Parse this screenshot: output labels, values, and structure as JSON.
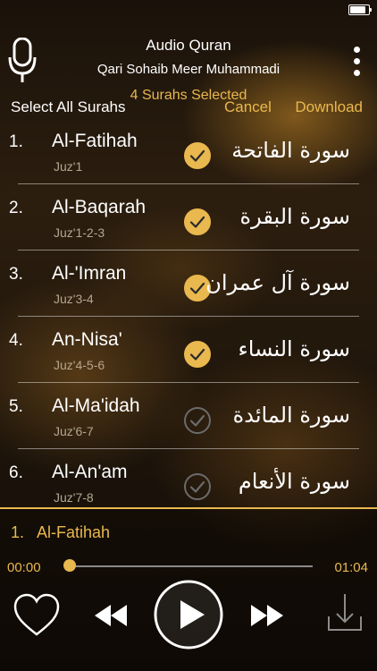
{
  "header": {
    "title": "Audio Quran",
    "reciter": "Qari Sohaib Meer Muhammadi",
    "selected_count": "4 Surahs Selected"
  },
  "actions": {
    "select_all": "Select All Surahs",
    "cancel": "Cancel",
    "download": "Download"
  },
  "surahs": [
    {
      "num": "1.",
      "name": "Al-Fatihah",
      "juz": "Juz'1",
      "arabic": "سورة الفاتحة",
      "selected": true
    },
    {
      "num": "2.",
      "name": "Al-Baqarah",
      "juz": "Juz'1-2-3",
      "arabic": "سورة البقرة",
      "selected": true
    },
    {
      "num": "3.",
      "name": "Al-'Imran",
      "juz": "Juz'3-4",
      "arabic": "سورة آل عمران",
      "selected": true
    },
    {
      "num": "4.",
      "name": "An-Nisa'",
      "juz": "Juz'4-5-6",
      "arabic": "سورة النساء",
      "selected": true
    },
    {
      "num": "5.",
      "name": "Al-Ma'idah",
      "juz": "Juz'6-7",
      "arabic": "سورة المائدة",
      "selected": false
    },
    {
      "num": "6.",
      "name": "Al-An'am",
      "juz": "Juz'7-8",
      "arabic": "سورة الأنعام",
      "selected": false
    }
  ],
  "player": {
    "now_playing_num": "1.",
    "now_playing_title": "Al-Fatihah",
    "elapsed": "00:00",
    "total": "01:04",
    "progress": 0
  },
  "colors": {
    "accent": "#e9b84e",
    "check_selected": "#e9b84e",
    "check_unselected": "#6b6b6b"
  },
  "icons": {
    "mic": "microphone-icon",
    "menu": "more-vertical-icon",
    "check": "checkmark-circle-icon",
    "heart": "heart-icon",
    "rewind": "rewind-icon",
    "play": "play-icon",
    "forward": "fast-forward-icon",
    "download": "download-icon"
  }
}
